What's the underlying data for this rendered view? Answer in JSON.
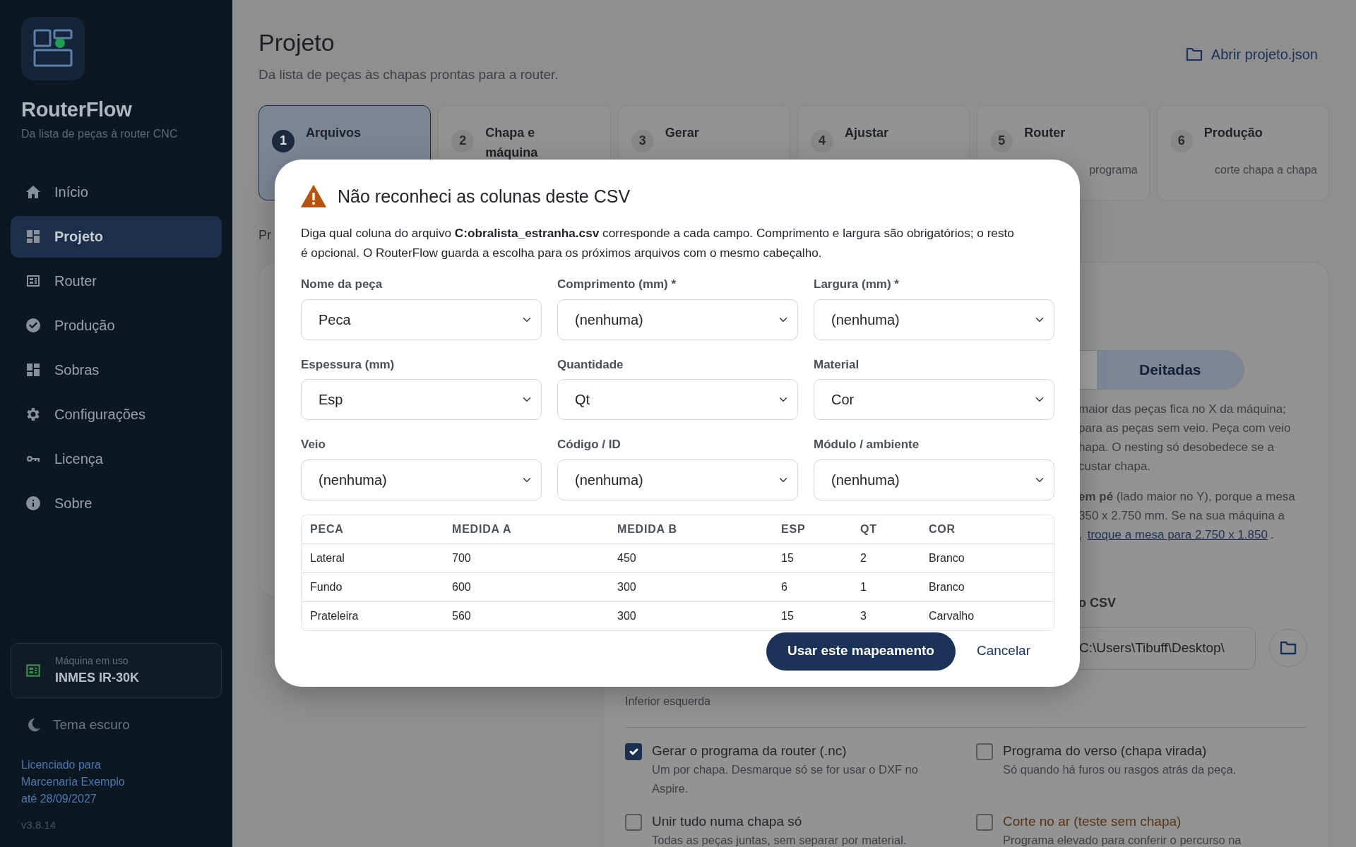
{
  "sidebar": {
    "app_name": "RouterFlow",
    "tagline": "Da lista de peças à router CNC",
    "nav": [
      {
        "label": "Início",
        "selected": false
      },
      {
        "label": "Projeto",
        "selected": true
      },
      {
        "label": "Router",
        "selected": false
      },
      {
        "label": "Produção",
        "selected": false
      },
      {
        "label": "Sobras",
        "selected": false
      },
      {
        "label": "Configurações",
        "selected": false
      },
      {
        "label": "Licença",
        "selected": false
      },
      {
        "label": "Sobre",
        "selected": false
      }
    ],
    "machine": {
      "caption": "Máquina em uso",
      "name": "INMES IR-30K"
    },
    "theme_toggle": "Tema escuro",
    "license": [
      "Licenciado para",
      "Marcenaria Exemplo",
      "até 28/09/2027"
    ],
    "version": "v3.8.14"
  },
  "page": {
    "title": "Projeto",
    "subtitle": "Da lista de peças às chapas prontas para a router.",
    "open_button": "Abrir projeto.json"
  },
  "steps": [
    {
      "number": "1",
      "title": "Arquivos",
      "selected": true
    },
    {
      "number": "2",
      "title": "Chapa e máquina",
      "selected": false
    },
    {
      "number": "3",
      "title": "Gerar",
      "selected": false
    },
    {
      "number": "4",
      "title": "Ajustar",
      "selected": false
    },
    {
      "number": "5",
      "title": "Router",
      "subtitle": "programa",
      "selected": false
    },
    {
      "number": "6",
      "title": "Produção",
      "subtitle": "corte chapa a chapa",
      "selected": false
    }
  ],
  "section_fragment": "Pr",
  "panel": {
    "orientation": [
      {
        "selected": false
      },
      {
        "label": "Deitadas",
        "selected": true
      }
    ],
    "note_lines": [
      "maior das peças fica no X da máquina;",
      "para as peças sem veio. Peça com veio",
      "hapa. O nesting só desobedece se a",
      "custar chapa."
    ],
    "table_note_lines": [
      "**em pé** (lado maior no Y), porque a mesa",
      "350 x 2.750 mm. Se na sua máquina a"
    ],
    "table_note_link": {
      "prefix": ",",
      "link": "troque a mesa para 2.750 x 1.850",
      "suffix": "."
    },
    "csv_heading": "o CSV",
    "csv_path": "C:\\Users\\Tibuff\\Desktop\\",
    "origin_value": "Inferior esquerda",
    "options": [
      {
        "label": "Gerar o programa da router (.nc)",
        "description": "Um por chapa. Desmarque só se for usar o DXF no Aspire.",
        "checked": true,
        "warning": false
      },
      {
        "label": "Programa do verso (chapa virada)",
        "description": "Só quando há furos ou rasgos atrás da peça.",
        "checked": false,
        "warning": false
      },
      {
        "label": "Unir tudo numa chapa só",
        "description": "Todas as peças juntas, sem separar por material.",
        "checked": false,
        "warning": false
      },
      {
        "label": "Corte no ar (teste sem chapa)",
        "description": "Programa elevado para conferir o percurso na",
        "checked": false,
        "warning": true
      }
    ]
  },
  "dialog": {
    "title": "Não reconheci as colunas deste CSV",
    "intro": "Diga qual coluna do arquivo **C:obralista_estranha.csv** corresponde a cada campo. Comprimento e largura são obrigatórios; o resto é opcional. O RouterFlow guarda a escolha para os próximos arquivos com o mesmo cabeçalho.",
    "fields": [
      {
        "label": "Nome da peça",
        "value": "Peca"
      },
      {
        "label": "Comprimento (mm) *",
        "value": "(nenhuma)"
      },
      {
        "label": "Largura (mm) *",
        "value": "(nenhuma)"
      },
      {
        "label": "Espessura (mm)",
        "value": "Esp"
      },
      {
        "label": "Quantidade",
        "value": "Qt"
      },
      {
        "label": "Material",
        "value": "Cor"
      },
      {
        "label": "Veio",
        "value": "(nenhuma)"
      },
      {
        "label": "Código / ID",
        "value": "(nenhuma)"
      },
      {
        "label": "Módulo / ambiente",
        "value": "(nenhuma)"
      }
    ],
    "preview": {
      "columns": [
        "PECA",
        "MEDIDA A",
        "MEDIDA B",
        "ESP",
        "QT",
        "COR"
      ],
      "rows": [
        [
          "Lateral",
          "700",
          "450",
          "15",
          "2",
          "Branco"
        ],
        [
          "Fundo",
          "600",
          "300",
          "6",
          "1",
          "Branco"
        ],
        [
          "Prateleira",
          "560",
          "300",
          "15",
          "3",
          "Carvalho"
        ]
      ]
    },
    "confirm_button": "Usar este mapeamento",
    "cancel_button": "Cancelar"
  }
}
